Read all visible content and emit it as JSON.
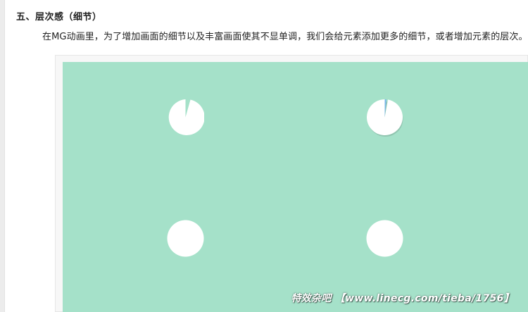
{
  "article": {
    "heading": "五、层次感（细节）",
    "paragraph": "在MG动画里，为了增加画面的细节以及丰富画面使其不显单调，我们会给元素添加更多的细节，或者增加元素的层次。"
  },
  "figure": {
    "background_color": "#a5e1c9",
    "circle_color": "#ffffff",
    "detail_color": "#7ab8e8",
    "watermark": "特效杂吧 【www.linecg.com/tieba/1756】",
    "circles": [
      {
        "label": "pie-gap-plain",
        "wedge": true,
        "shaded": false,
        "gap_fraction": 0.06
      },
      {
        "label": "pie-gap-detailed",
        "wedge": true,
        "shaded": true,
        "gap_fraction": 0.04
      },
      {
        "label": "circle-plain",
        "wedge": false,
        "shaded": false
      },
      {
        "label": "circle-plain-2",
        "wedge": false,
        "shaded": false
      }
    ]
  }
}
